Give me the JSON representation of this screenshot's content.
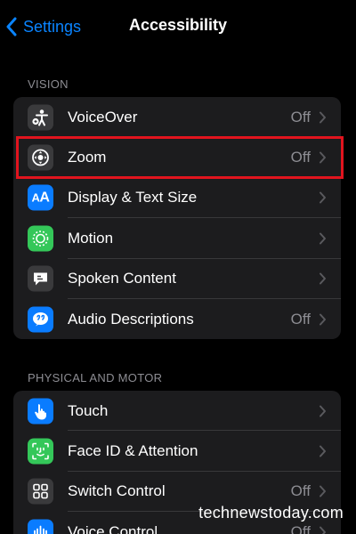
{
  "nav": {
    "back_label": "Settings",
    "title": "Accessibility"
  },
  "colors": {
    "accent": "#0a84ff",
    "highlight": "#e1141e",
    "background": "#000000",
    "cell": "#1c1c1e",
    "secondary_text": "#8d8d93"
  },
  "sections": [
    {
      "header": "VISION",
      "items": [
        {
          "label": "VoiceOver",
          "value": "Off",
          "icon": "voiceover-icon",
          "icon_color": "#3a3a3c"
        },
        {
          "label": "Zoom",
          "value": "Off",
          "icon": "zoom-icon",
          "icon_color": "#3a3a3c"
        },
        {
          "label": "Display & Text Size",
          "value": "",
          "icon": "text-size-icon",
          "icon_color": "#0a7cff"
        },
        {
          "label": "Motion",
          "value": "",
          "icon": "motion-icon",
          "icon_color": "#34c759"
        },
        {
          "label": "Spoken Content",
          "value": "",
          "icon": "spoken-content-icon",
          "icon_color": "#3a3a3c"
        },
        {
          "label": "Audio Descriptions",
          "value": "Off",
          "icon": "audio-descriptions-icon",
          "icon_color": "#0a7cff"
        }
      ]
    },
    {
      "header": "PHYSICAL AND MOTOR",
      "items": [
        {
          "label": "Touch",
          "value": "",
          "icon": "touch-hand-icon",
          "icon_color": "#0a7cff"
        },
        {
          "label": "Face ID & Attention",
          "value": "",
          "icon": "face-id-icon",
          "icon_color": "#34c759"
        },
        {
          "label": "Switch Control",
          "value": "Off",
          "icon": "switch-control-icon",
          "icon_color": "#3a3a3c"
        },
        {
          "label": "Voice Control",
          "value": "Off",
          "icon": "voice-control-icon",
          "icon_color": "#0a7cff"
        }
      ]
    }
  ],
  "watermark": "technewstoday.com"
}
